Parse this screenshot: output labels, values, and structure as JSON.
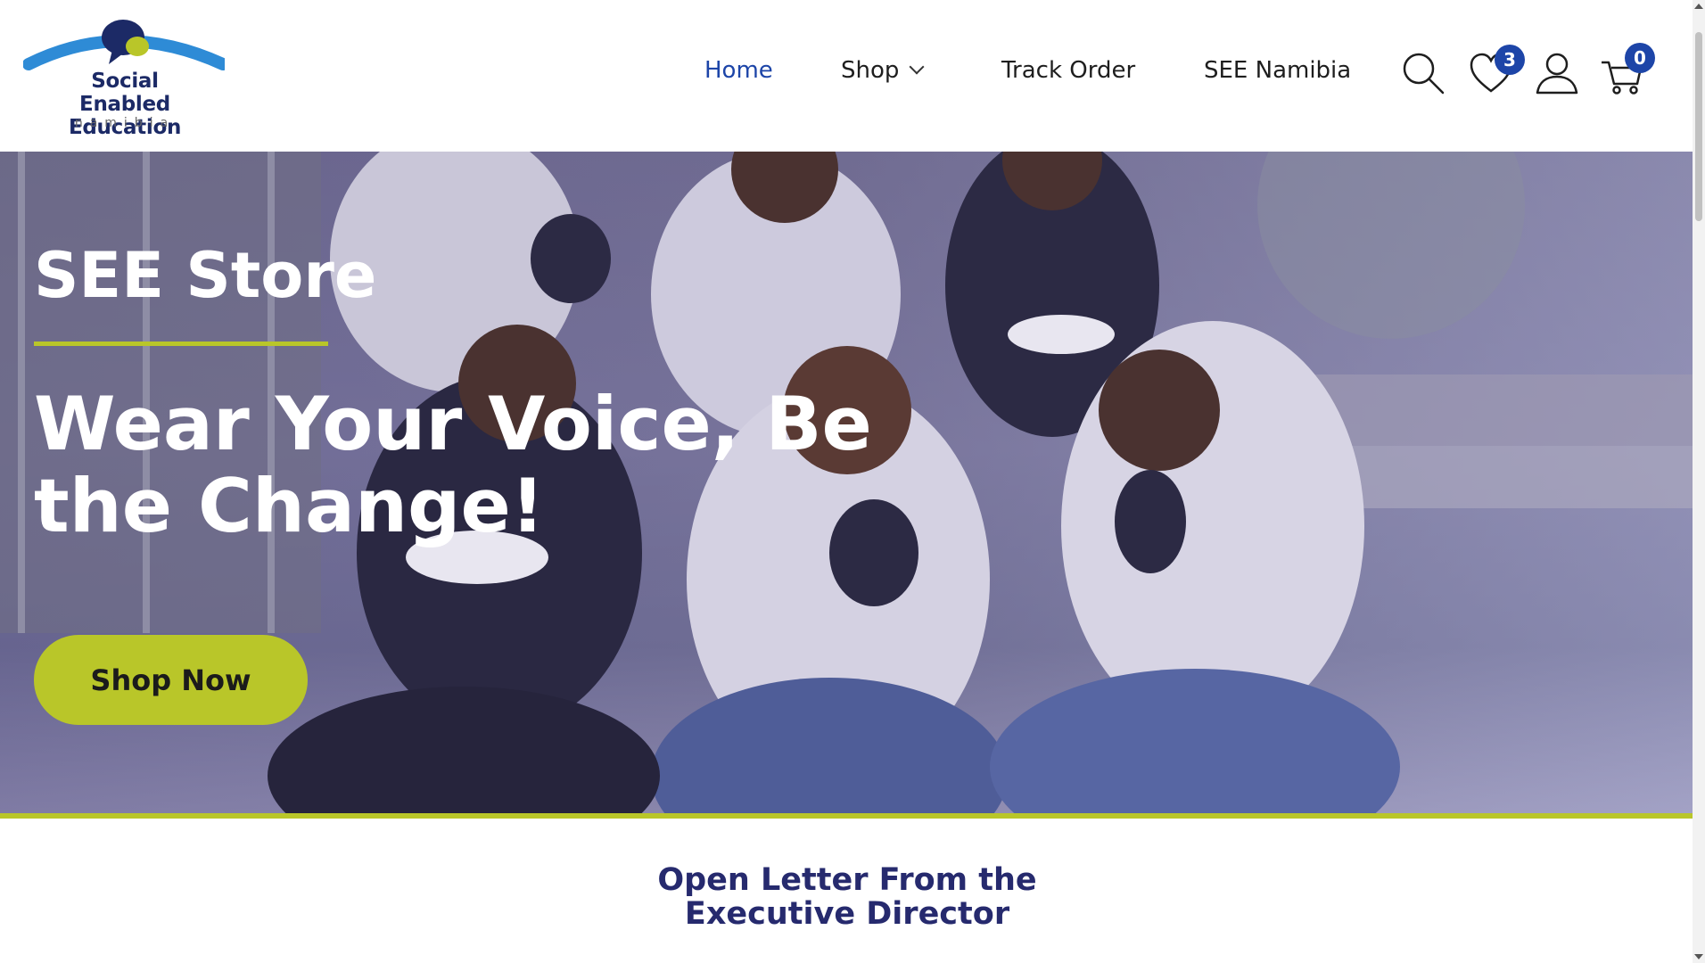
{
  "header": {
    "logo": {
      "line1": "Social Enabled",
      "line2": "Education",
      "sub": "namibia"
    },
    "nav": [
      {
        "label": "Home",
        "active": true
      },
      {
        "label": "Shop",
        "dropdown": true
      },
      {
        "label": "Track Order"
      },
      {
        "label": "SEE Namibia"
      }
    ],
    "icons": {
      "search": "search-icon",
      "wishlist": "heart-icon",
      "account": "user-icon",
      "cart": "cart-icon"
    },
    "wishlist_count": "3",
    "cart_count": "0"
  },
  "hero": {
    "store_title": "SEE Store",
    "headline_line1": "Wear Your Voice, Be",
    "headline_line2": "the Change!",
    "cta_label": "Shop Now"
  },
  "section": {
    "title_line1": "Open Letter From the",
    "title_line2": "Executive Director"
  },
  "colors": {
    "brand_blue": "#1d45a8",
    "accent_lime": "#b9c629",
    "navy": "#262a6e"
  }
}
